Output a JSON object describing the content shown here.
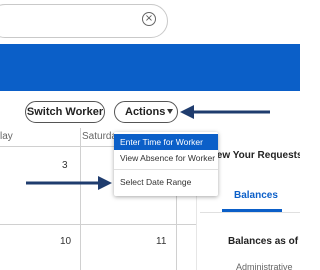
{
  "calendar": {
    "day_headers": [
      "lay",
      "Saturday"
    ],
    "dates": [
      "3",
      "10",
      "11"
    ]
  },
  "toolbar": {
    "switch_worker_label": "Switch Worker",
    "actions_label": "Actions"
  },
  "actions_menu": {
    "items": [
      "Enter Time for Worker",
      "View Absence for Worker",
      "Select Date Range"
    ]
  },
  "right_panel": {
    "header": "iew Your Requests a",
    "tabs": [
      "Balances"
    ],
    "balances_as_of": "Balances as of",
    "partial_text": "Administrative"
  },
  "colors": {
    "brand_blue": "#0b5fc8",
    "annotation_arrow": "#1f3c6e"
  }
}
